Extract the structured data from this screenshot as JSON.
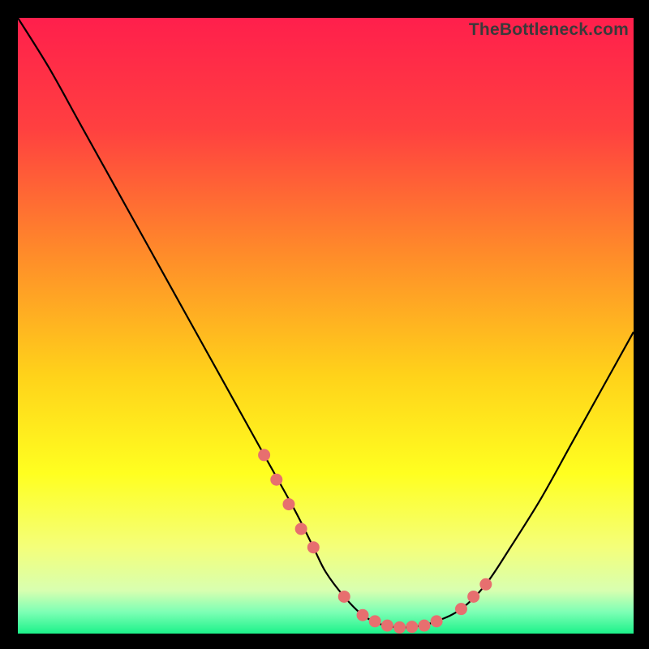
{
  "watermark": "TheBottleneck.com",
  "colors": {
    "frame": "#000000",
    "curve": "#000000",
    "marker": "#e76f6f",
    "gradient_stops": [
      {
        "pos": 0.0,
        "color": "#ff1f4c"
      },
      {
        "pos": 0.18,
        "color": "#ff4040"
      },
      {
        "pos": 0.38,
        "color": "#ff8a2a"
      },
      {
        "pos": 0.58,
        "color": "#ffd21a"
      },
      {
        "pos": 0.74,
        "color": "#ffff20"
      },
      {
        "pos": 0.86,
        "color": "#f4ff7a"
      },
      {
        "pos": 0.93,
        "color": "#d8ffb0"
      },
      {
        "pos": 0.965,
        "color": "#7dffb5"
      },
      {
        "pos": 1.0,
        "color": "#1cf28a"
      }
    ]
  },
  "chart_data": {
    "type": "line",
    "title": "",
    "xlabel": "",
    "ylabel": "",
    "xlim": [
      0,
      100
    ],
    "ylim": [
      0,
      100
    ],
    "grid": false,
    "legend": false,
    "series": [
      {
        "name": "bottleneck-curve",
        "x": [
          0,
          5,
          10,
          15,
          20,
          25,
          30,
          35,
          40,
          45,
          48,
          50,
          53,
          56,
          59,
          62,
          65,
          68,
          72,
          76,
          80,
          85,
          90,
          95,
          100
        ],
        "y": [
          100,
          92,
          83,
          74,
          65,
          56,
          47,
          38,
          29,
          20,
          14,
          10,
          6,
          3,
          1.5,
          1,
          1.2,
          2,
          4,
          8,
          14,
          22,
          31,
          40,
          49
        ]
      }
    ],
    "markers": {
      "name": "highlight-points",
      "x": [
        40,
        42,
        44,
        46,
        48,
        53,
        56,
        58,
        60,
        62,
        64,
        66,
        68,
        72,
        74,
        76
      ],
      "y": [
        29,
        25,
        21,
        17,
        14,
        6,
        3,
        2,
        1.3,
        1,
        1.1,
        1.3,
        2,
        4,
        6,
        8
      ]
    }
  }
}
